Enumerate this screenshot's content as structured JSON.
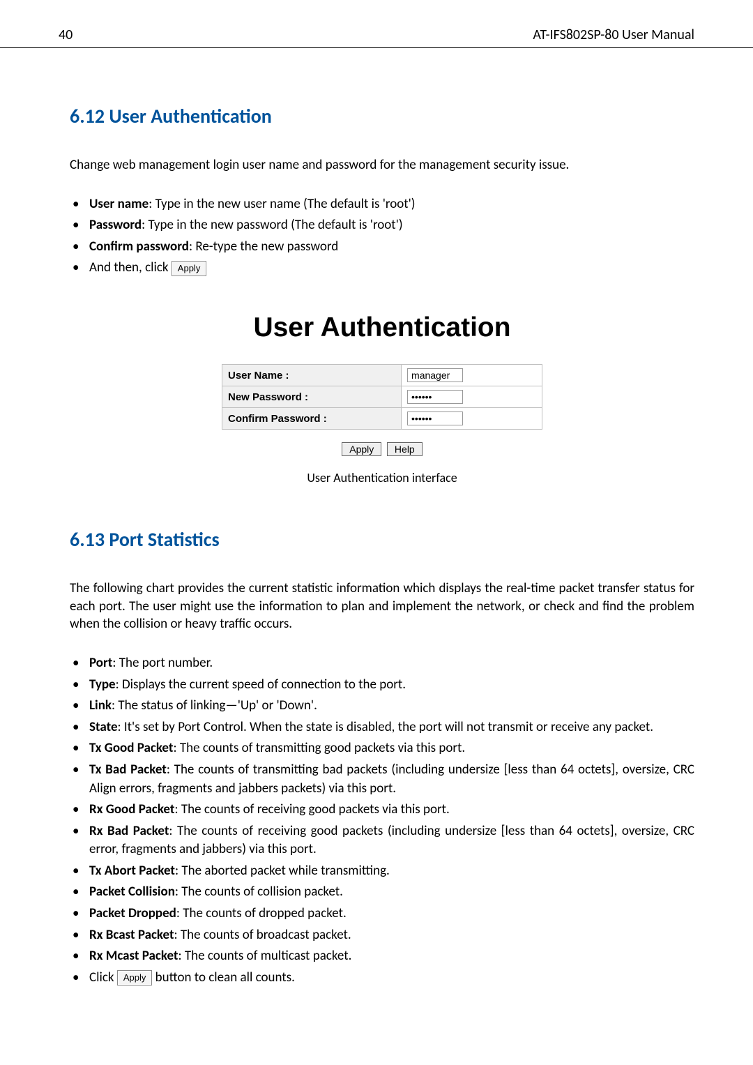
{
  "header": {
    "page_number": "40",
    "manual_title": "AT-IFS802SP-80 User Manual"
  },
  "section612": {
    "heading": "6.12 User Authentication",
    "intro": "Change web management login user name and password for the management security issue.",
    "items": {
      "user_name_b": "User name",
      "user_name_t": ": Type in the new user name (The default is 'root')",
      "password_b": "Password",
      "password_t": ": Type in the new password (The default is 'root')",
      "confirm_b": "Confirm password",
      "confirm_t": ": Re-type the new password",
      "andthen_pre": "And then, click ",
      "apply_btn": "Apply"
    },
    "figure": {
      "title": "User Authentication",
      "row1_label": "User Name :",
      "row1_value": "manager",
      "row2_label": "New Password :",
      "row2_value": "••••••",
      "row3_label": "Confirm Password :",
      "row3_value": "••••••",
      "btn_apply": "Apply",
      "btn_help": "Help",
      "caption": "User Authentication interface"
    }
  },
  "section613": {
    "heading": "6.13  Port Statistics",
    "intro": "The following chart provides the current statistic information which displays the real-time packet transfer status for each port. The user might use the information to plan and implement the network, or check and find the problem when the collision or heavy traffic occurs.",
    "items": {
      "port_b": "Port",
      "port_t": ": The port number.",
      "type_b": "Type",
      "type_t": ": Displays the current speed of connection to the port.",
      "link_b": "Link",
      "link_t": ": The status of linking—'Up' or 'Down'.",
      "state_b": "State",
      "state_t": ": It's set by Port Control. When the state is disabled, the port will not transmit or receive any packet.",
      "txg_b": "Tx Good Packet",
      "txg_t": ": The counts of transmitting good packets via this port.",
      "txb_b": "Tx Bad Packet",
      "txb_t": ": The counts of transmitting bad packets (including undersize [less than 64 octets], oversize, CRC Align errors, fragments and jabbers packets) via this port.",
      "rxg_b": "Rx Good Packet",
      "rxg_t": ": The counts of receiving good packets via this port.",
      "rxb_b": "Rx Bad Packet",
      "rxb_t": ": The counts of receiving good packets (including undersize [less than 64 octets], oversize, CRC error, fragments and jabbers) via this port.",
      "txa_b": "Tx Abort Packet",
      "txa_t": ": The aborted packet while transmitting.",
      "pcol_b": "Packet Collision",
      "pcol_t": ": The counts of collision packet.",
      "pdrop_b": "Packet Dropped",
      "pdrop_t": ": The counts of dropped packet.",
      "rxbc_b": "Rx Bcast Packet",
      "rxbc_t": ": The counts of broadcast packet.",
      "rxmc_b": "Rx Mcast Packet",
      "rxmc_t": ": The counts of multicast packet.",
      "click_pre": "Click ",
      "apply_btn": "Apply",
      "click_post": " button to clean all counts."
    }
  }
}
